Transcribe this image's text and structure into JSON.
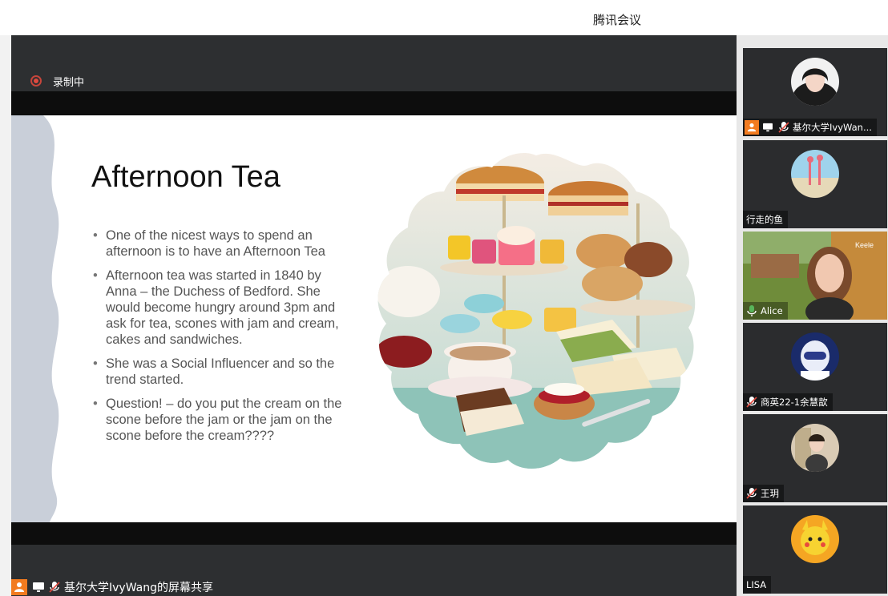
{
  "window": {
    "title": "腾讯会议"
  },
  "recording": {
    "label": "录制中"
  },
  "slide": {
    "title": "Afternoon Tea",
    "bullets": [
      "One of the nicest ways to spend an afternoon is to have an Afternoon Tea",
      "Afternoon tea was started in 1840 by Anna – the Duchess of Bedford. She would become hungry around 3pm and ask for tea, scones with jam and cream, cakes and sandwiches.",
      "She was a Social Influencer and so the trend started.",
      "Question! – do you put the cream on the scone before the jam or the jam on the scone before the cream????"
    ]
  },
  "share": {
    "label": "基尔大学IvyWang的屏幕共享"
  },
  "participants": [
    {
      "name": "基尔大学IvyWan...",
      "host": true,
      "sharing": true,
      "muted": true
    },
    {
      "name": "行走的鱼",
      "host": false,
      "sharing": false,
      "muted": false
    },
    {
      "name": "Alice",
      "host": false,
      "sharing": false,
      "muted": false,
      "speaking": true,
      "video_overlay": "Keele"
    },
    {
      "name": "商英22-1余慧歆",
      "host": false,
      "sharing": false,
      "muted": true
    },
    {
      "name": "王玥",
      "host": false,
      "sharing": false,
      "muted": true
    },
    {
      "name": "LISA",
      "host": false,
      "sharing": false,
      "muted": false
    }
  ],
  "colors": {
    "host_orange": "#f27b1f",
    "speaking_green": "#58b55a",
    "record_red": "#e04a3f"
  }
}
